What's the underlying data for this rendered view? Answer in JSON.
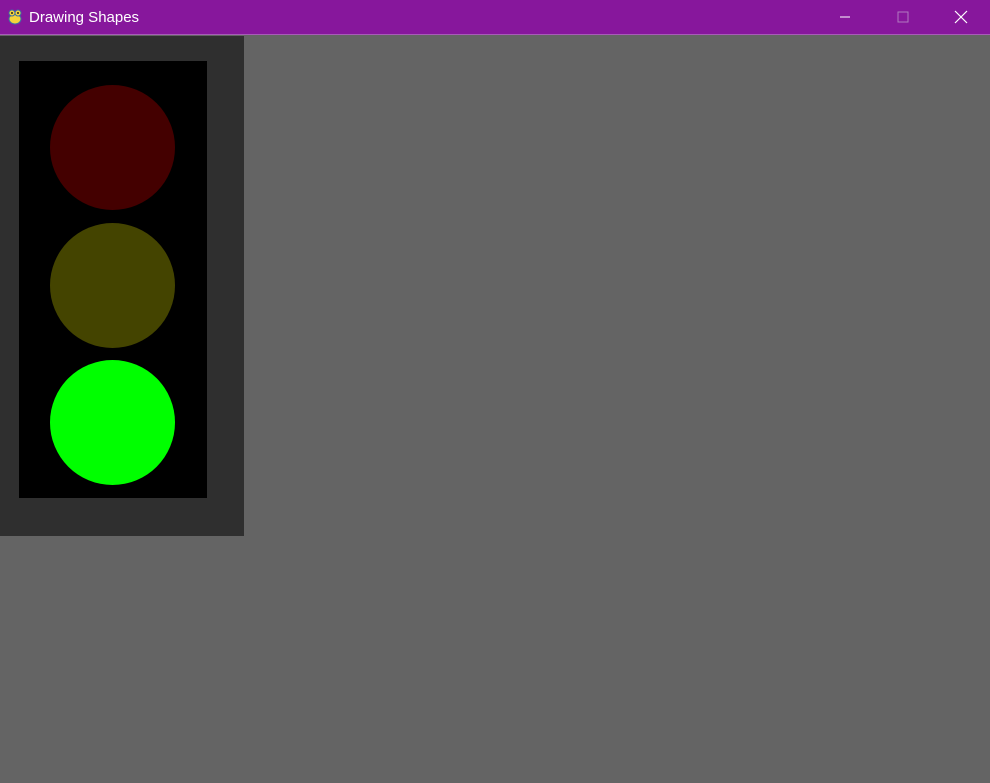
{
  "window": {
    "title": "Drawing Shapes",
    "app_icon": "pygame-snake-icon",
    "controls": {
      "minimize_icon": "minimize-icon",
      "maximize_icon": "maximize-icon",
      "close_icon": "close-icon"
    }
  },
  "colors": {
    "titlebar": "#87179c",
    "background": "#646464",
    "panel": "#2f2f2f",
    "housing": "#000000",
    "red_lamp": "#440000",
    "yellow_lamp": "#444400",
    "green_lamp": "#00ff00"
  },
  "traffic_light": {
    "lamps": [
      {
        "name": "red",
        "state": "off"
      },
      {
        "name": "yellow",
        "state": "off"
      },
      {
        "name": "green",
        "state": "on"
      }
    ]
  }
}
